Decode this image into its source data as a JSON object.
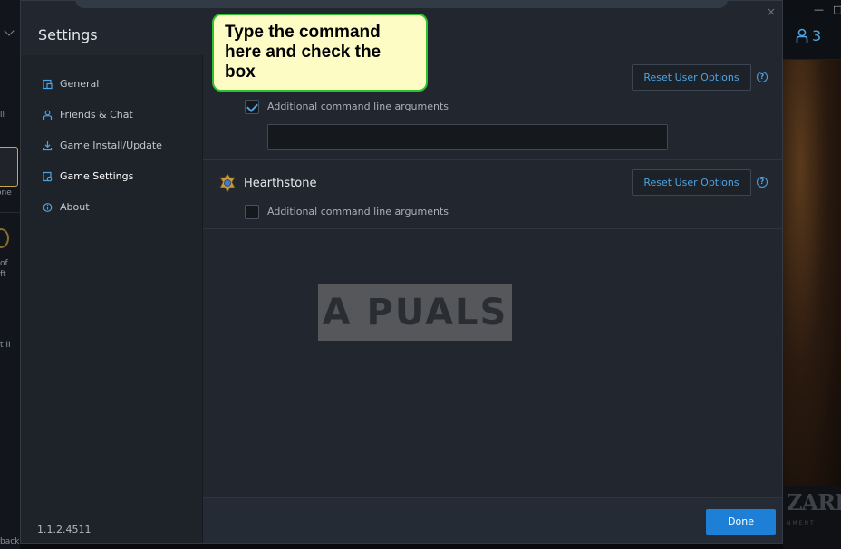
{
  "dialog": {
    "title": "Settings",
    "close_glyph": "×"
  },
  "sidebar": {
    "items": [
      {
        "label": "General",
        "icon": "general-icon"
      },
      {
        "label": "Friends & Chat",
        "icon": "friends-icon"
      },
      {
        "label": "Game Install/Update",
        "icon": "download-icon"
      },
      {
        "label": "Game Settings",
        "icon": "game-settings-icon",
        "active": true
      },
      {
        "label": "About",
        "icon": "info-icon"
      }
    ],
    "version": "1.1.2.4511"
  },
  "sections": [
    {
      "game": "",
      "reset_label": "Reset User Options",
      "help_glyph": "?",
      "checkbox_label": "Additional command line arguments",
      "checked": true,
      "input_value": ""
    },
    {
      "game": "Hearthstone",
      "reset_label": "Reset User Options",
      "help_glyph": "?",
      "checkbox_label": "Additional command line arguments",
      "checked": false
    }
  ],
  "footer": {
    "done_label": "Done"
  },
  "callout": {
    "text": "Type the command here and check the box"
  },
  "watermark": {
    "text": "A PUALS"
  },
  "background": {
    "left_fragments": [
      "ll",
      "one",
      "of",
      "ft",
      "t II",
      "back"
    ],
    "friends_count": "3",
    "window_buttons": [
      "—",
      "□"
    ],
    "brand_text": "ZARD",
    "brand_sub": "NMENT"
  },
  "colors": {
    "accent": "#4ea3e2",
    "primary_button": "#1d7fd6",
    "callout_border": "#2ec12e",
    "callout_fill": "#fcfcc4"
  }
}
